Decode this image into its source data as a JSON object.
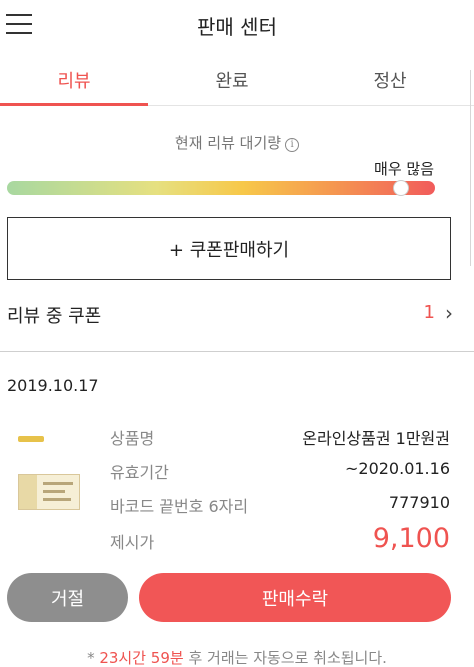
{
  "header": {
    "title": "판매 센터"
  },
  "tabs": [
    {
      "label": "리뷰",
      "active": true
    },
    {
      "label": "완료",
      "active": false
    },
    {
      "label": "정산",
      "active": false
    }
  ],
  "review_queue": {
    "label": "현재 리뷰 대기량",
    "info_glyph": "i",
    "level_text": "매우 많음",
    "level_fraction": 0.92,
    "gauge_colors": [
      "#a8d8a0",
      "#f7c84a",
      "#f15b5b"
    ]
  },
  "coupon_sell_button": {
    "label": "+ 쿠폰판매하기"
  },
  "reviewing": {
    "label": "리뷰 중 쿠폰",
    "count": "1",
    "chevron": "›"
  },
  "card": {
    "date": "2019.10.17",
    "details": [
      {
        "key": "상품명",
        "value": "온라인상품권 1만원권"
      },
      {
        "key": "유효기간",
        "value": "~2020.01.16"
      },
      {
        "key": "바코드 끝번호 6자리",
        "value": "777910"
      },
      {
        "key": "제시가",
        "value": "9,100"
      }
    ],
    "reject_label": "거절",
    "accept_label": "판매수락"
  },
  "notice": {
    "prefix": "* ",
    "time": "23시간 59분",
    "suffix": " 후 거래는 자동으로 취소됩니다."
  },
  "colors": {
    "accent": "#ef5350",
    "reject": "#8e8e8e",
    "accept": "#f15656"
  }
}
